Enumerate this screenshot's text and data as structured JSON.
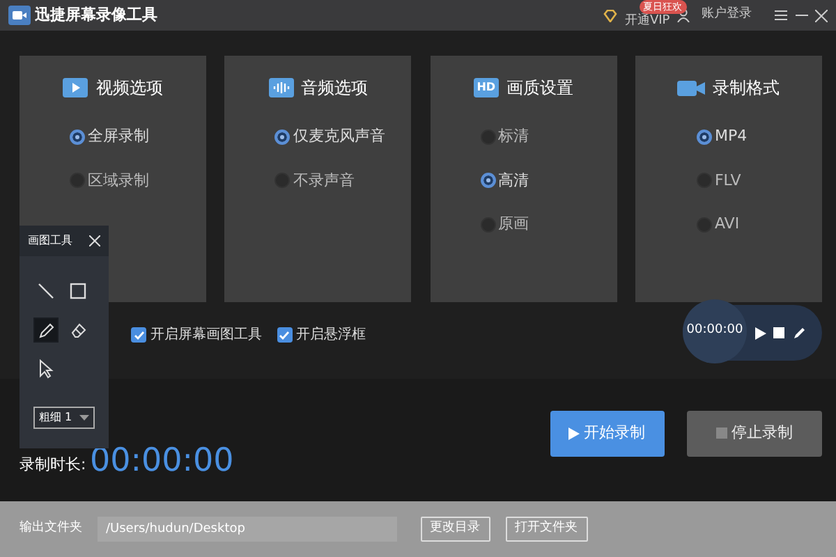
{
  "window": {
    "title": "迅捷屏幕录像工具",
    "vip": "开通VIP",
    "promo_badge": "夏日狂欢",
    "account": "账户登录"
  },
  "option_cards": [
    {
      "kind": "video",
      "title": "视频选项",
      "options": [
        {
          "label": "全屏录制",
          "selected": true
        },
        {
          "label": "区域录制",
          "selected": false
        }
      ]
    },
    {
      "kind": "audio",
      "title": "音频选项",
      "options": [
        {
          "label": "仅麦克风声音",
          "selected": true
        },
        {
          "label": "不录声音",
          "selected": false
        }
      ]
    },
    {
      "kind": "hd",
      "icon_text": "HD",
      "title": "画质设置",
      "options": [
        {
          "label": "标清",
          "selected": false
        },
        {
          "label": "高清",
          "selected": true
        },
        {
          "label": "原画",
          "selected": false
        }
      ]
    },
    {
      "kind": "format",
      "title": "录制格式",
      "options": [
        {
          "label": "MP4",
          "selected": true
        },
        {
          "label": "FLV",
          "selected": false
        },
        {
          "label": "AVI",
          "selected": false
        }
      ]
    }
  ],
  "checkboxes": [
    {
      "label": "开启屏幕画图工具",
      "checked": true
    },
    {
      "label": "开启悬浮框",
      "checked": true
    }
  ],
  "floating_bar": {
    "time": "00:00:00"
  },
  "drawing_tools": {
    "title": "画图工具",
    "tools": [
      {
        "kind": "line",
        "selected": false
      },
      {
        "kind": "rectangle",
        "selected": false
      },
      {
        "kind": "pen",
        "selected": true
      },
      {
        "kind": "eraser",
        "selected": false
      },
      {
        "kind": "pointer",
        "selected": false
      }
    ],
    "thickness": "粗细 1"
  },
  "recording": {
    "label": "录制时长:",
    "time": "00:00:00",
    "start": "开始录制",
    "stop": "停止录制"
  },
  "output": {
    "label": "输出文件夹",
    "path": "/Users/hudun/Desktop",
    "change": "更改目录",
    "open": "打开文件夹"
  }
}
